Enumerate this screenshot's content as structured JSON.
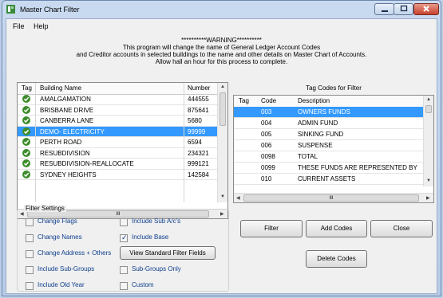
{
  "window": {
    "title": "Master Chart Filter"
  },
  "menu": [
    "File",
    "Help"
  ],
  "warning": [
    "**********WARNING**********",
    "This program will change the name of General Ledger Account Codes",
    "and Creditor accounts in  selected buildings to the name and other details on Master Chart of Accounts.",
    "Allow hall an hour for this process to complete."
  ],
  "buildings": {
    "headers": {
      "tag": "Tag",
      "name": "Building Name",
      "number": "Number"
    },
    "rows": [
      {
        "name": "AMALGAMATION",
        "number": "444555"
      },
      {
        "name": "BRISBANE DRIVE",
        "number": "875641"
      },
      {
        "name": "CANBERRA LANE",
        "number": "5680"
      },
      {
        "name": "DEMO- ELECTRICITY",
        "number": "99999"
      },
      {
        "name": "PERTH ROAD",
        "number": "6594"
      },
      {
        "name": "RESUBDIVISION",
        "number": "234321"
      },
      {
        "name": "RESUBDIVISION-REALLOCATE",
        "number": "999121"
      },
      {
        "name": "SYDNEY HEIGHTS",
        "number": "142584"
      }
    ],
    "scroll_label": "III"
  },
  "tagcodes": {
    "title": "Tag Codes for Filter",
    "headers": {
      "tag": "Tag",
      "code": "Code",
      "desc": "Description"
    },
    "rows": [
      {
        "code": "003",
        "desc": "OWNERS FUNDS"
      },
      {
        "code": "004",
        "desc": "ADMIN FUND"
      },
      {
        "code": "005",
        "desc": "SINKING FUND"
      },
      {
        "code": "006",
        "desc": "SUSPENSE"
      },
      {
        "code": "0098",
        "desc": "TOTAL"
      },
      {
        "code": "0099",
        "desc": "THESE FUNDS ARE REPRESENTED BY"
      },
      {
        "code": "010",
        "desc": "CURRENT ASSETS"
      }
    ],
    "scroll_label": "III"
  },
  "filter": {
    "legend": "Filter Settings",
    "left": [
      {
        "label": "Change Flags",
        "checked": false
      },
      {
        "label": "Change Names",
        "checked": false
      },
      {
        "label": "Change Address + Others",
        "checked": false
      },
      {
        "label": "Include Sub-Groups",
        "checked": false
      },
      {
        "label": "Include Old Year",
        "checked": false
      }
    ],
    "right": [
      {
        "label": "Include Sub A/c's",
        "checked": false
      },
      {
        "label": "Include Base",
        "checked": true
      },
      {
        "label": "Sub-Groups Only",
        "checked": false
      },
      {
        "label": "Custom",
        "checked": false
      }
    ],
    "view_button": "View Standard Filter Fields"
  },
  "buttons": {
    "filter": "Filter",
    "add": "Add Codes",
    "close": "Close",
    "delete": "Delete Codes"
  },
  "colors": {
    "selection": "#3399ff",
    "tag_check": "#3c8c2a",
    "checkbox_label": "#0d3f8e"
  }
}
